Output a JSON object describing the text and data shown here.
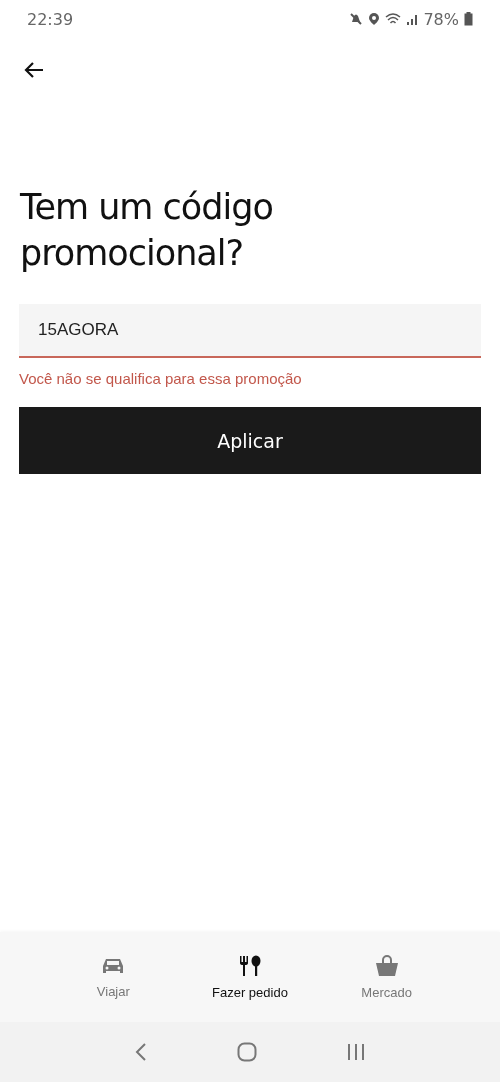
{
  "status_bar": {
    "time": "22:39",
    "battery": "78%"
  },
  "title": "Tem um código promocional?",
  "promo_field": {
    "value": "15AGORA",
    "error": "Você não se qualifica para essa promoção"
  },
  "apply_button": "Aplicar",
  "tabs": [
    {
      "label": "Viajar",
      "kind": "car",
      "selected": false
    },
    {
      "label": "Fazer pedido",
      "kind": "utensils",
      "selected": true
    },
    {
      "label": "Mercado",
      "kind": "bag",
      "selected": false
    }
  ]
}
